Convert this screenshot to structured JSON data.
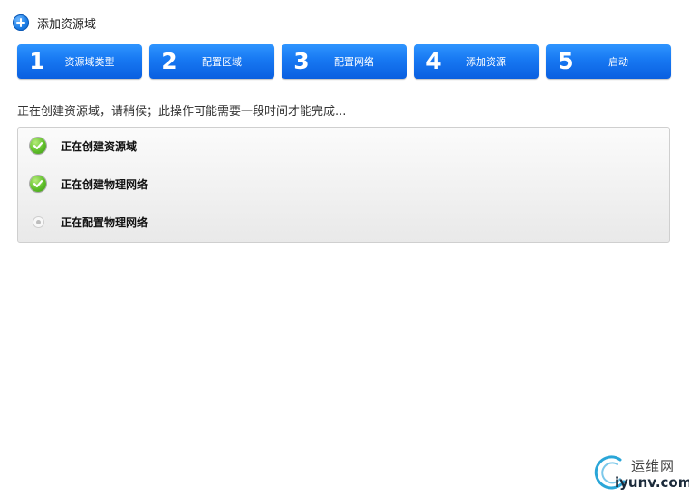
{
  "header": {
    "title": "添加资源域",
    "icon": "plus-icon"
  },
  "steps": [
    {
      "num": "1",
      "label": "资源域类型"
    },
    {
      "num": "2",
      "label": "配置区域"
    },
    {
      "num": "3",
      "label": "配置网络"
    },
    {
      "num": "4",
      "label": "添加资源"
    },
    {
      "num": "5",
      "label": "启动"
    }
  ],
  "status_message": "正在创建资源域，请稍候；此操作可能需要一段时间才能完成...",
  "tasks": [
    {
      "label": "正在创建资源域",
      "state": "done",
      "icon": "check-icon"
    },
    {
      "label": "正在创建物理网络",
      "state": "done",
      "icon": "check-icon"
    },
    {
      "label": "正在配置物理网络",
      "state": "pending",
      "icon": "pending-icon"
    }
  ],
  "watermark": {
    "name_cn": "运维网",
    "domain": "iyunv.com"
  },
  "colors": {
    "step_blue": "#1778f2",
    "check_green": "#5fbf2a",
    "panel_border": "#cfcfcf"
  }
}
